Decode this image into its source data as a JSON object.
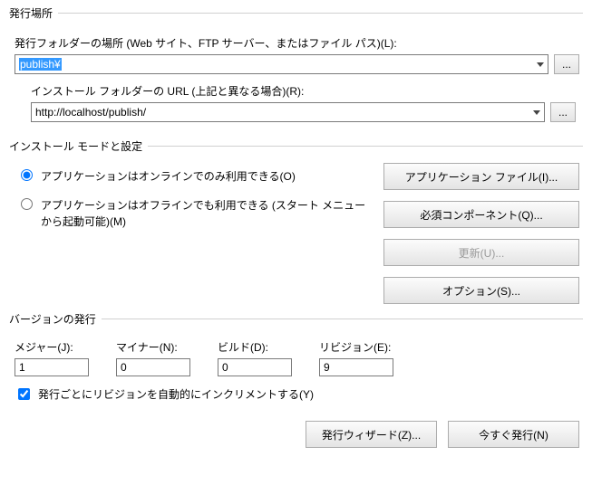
{
  "publishLocation": {
    "legend": "発行場所",
    "folderLabel": "発行フォルダーの場所 (Web サイト、FTP サーバー、またはファイル パス)(L):",
    "folderValue": "publish¥",
    "browse": "...",
    "installLabel": "インストール フォルダーの URL (上記と異なる場合)(R):",
    "installValue": "http://localhost/publish/",
    "browse2": "..."
  },
  "installMode": {
    "legend": "インストール モードと設定",
    "onlineOnly": "アプリケーションはオンラインでのみ利用できる(O)",
    "offline": "アプリケーションはオフラインでも利用できる (スタート メニューから起動可能)(M)",
    "btnAppFiles": "アプリケーション ファイル(I)...",
    "btnPrereq": "必須コンポーネント(Q)...",
    "btnUpdate": "更新(U)...",
    "btnOptions": "オプション(S)..."
  },
  "version": {
    "legend": "バージョンの発行",
    "majorLabel": "メジャー(J):",
    "minorLabel": "マイナー(N):",
    "buildLabel": "ビルド(D):",
    "revisionLabel": "リビジョン(E):",
    "major": "1",
    "minor": "0",
    "build": "0",
    "revision": "9",
    "autoIncrement": "発行ごとにリビジョンを自動的にインクリメントする(Y)"
  },
  "bottom": {
    "wizard": "発行ウィザード(Z)...",
    "publishNow": "今すぐ発行(N)"
  }
}
